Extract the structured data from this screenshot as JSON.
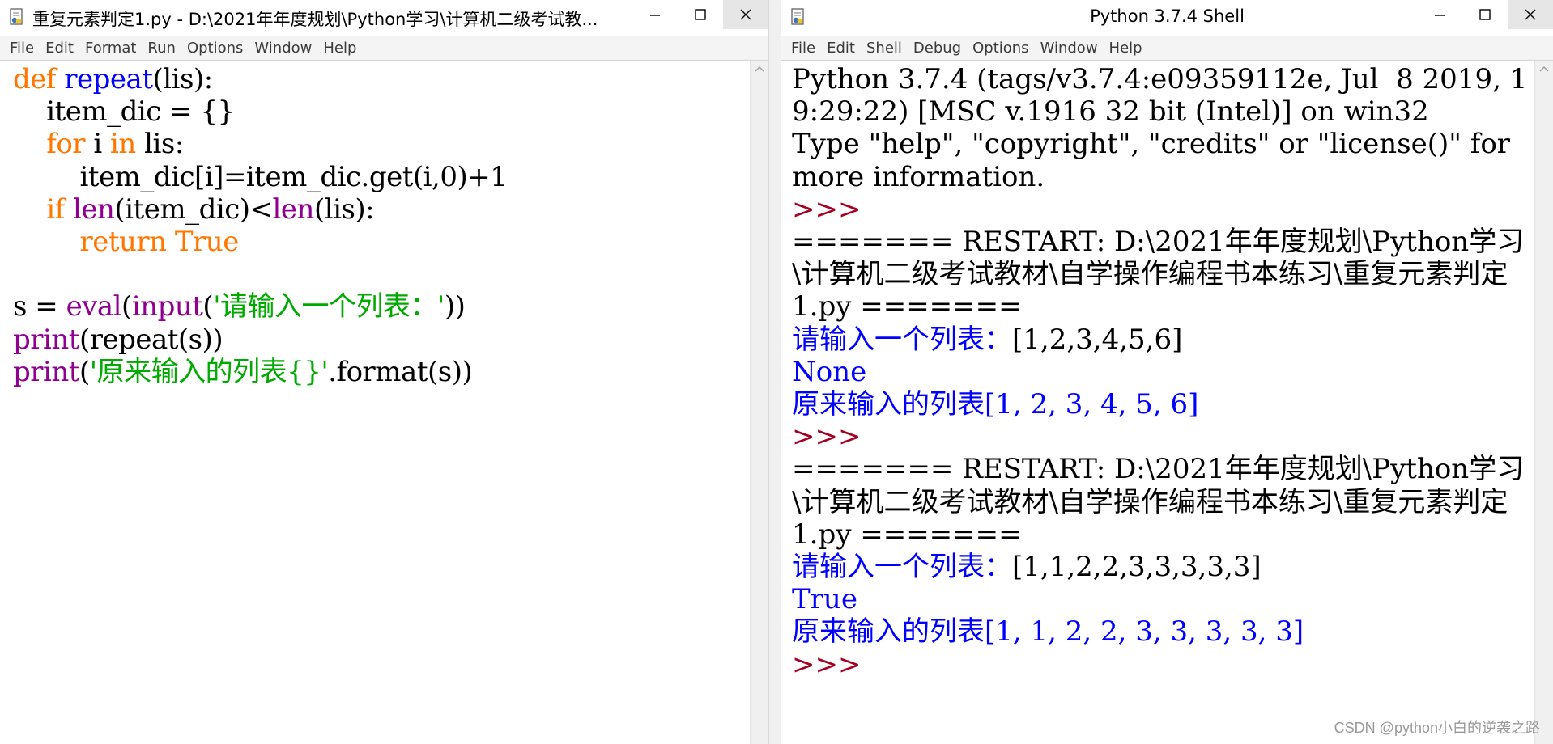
{
  "editor": {
    "title": "重复元素判定1.py - D:\\2021年年度规划\\Python学习\\计算机二级考试教...",
    "menu": [
      "File",
      "Edit",
      "Format",
      "Run",
      "Options",
      "Window",
      "Help"
    ],
    "code_lines": [
      [
        {
          "t": "def",
          "c": "kw"
        },
        {
          "t": " ",
          "c": ""
        },
        {
          "t": "repeat",
          "c": "def"
        },
        {
          "t": "(lis):",
          "c": ""
        }
      ],
      [
        {
          "t": "    item_dic = {}",
          "c": ""
        }
      ],
      [
        {
          "t": "    ",
          "c": ""
        },
        {
          "t": "for",
          "c": "kw"
        },
        {
          "t": " i ",
          "c": ""
        },
        {
          "t": "in",
          "c": "kw"
        },
        {
          "t": " lis:",
          "c": ""
        }
      ],
      [
        {
          "t": "        item_dic[i]=item_dic.get(i,0)+1",
          "c": ""
        }
      ],
      [
        {
          "t": "    ",
          "c": ""
        },
        {
          "t": "if",
          "c": "kw"
        },
        {
          "t": " ",
          "c": ""
        },
        {
          "t": "len",
          "c": "bi"
        },
        {
          "t": "(item_dic)<",
          "c": ""
        },
        {
          "t": "len",
          "c": "bi"
        },
        {
          "t": "(lis):",
          "c": ""
        }
      ],
      [
        {
          "t": "        ",
          "c": ""
        },
        {
          "t": "return",
          "c": "kw"
        },
        {
          "t": " ",
          "c": ""
        },
        {
          "t": "True",
          "c": "kw"
        }
      ],
      [],
      [
        {
          "t": "s = ",
          "c": ""
        },
        {
          "t": "eval",
          "c": "bi"
        },
        {
          "t": "(",
          "c": ""
        },
        {
          "t": "input",
          "c": "bi"
        },
        {
          "t": "(",
          "c": ""
        },
        {
          "t": "'请输入一个列表：'",
          "c": "str"
        },
        {
          "t": "))",
          "c": ""
        }
      ],
      [
        {
          "t": "print",
          "c": "bi"
        },
        {
          "t": "(repeat(s))",
          "c": ""
        }
      ],
      [
        {
          "t": "print",
          "c": "bi"
        },
        {
          "t": "(",
          "c": ""
        },
        {
          "t": "'原来输入的列表{}'",
          "c": "str"
        },
        {
          "t": ".format(s))",
          "c": ""
        }
      ]
    ]
  },
  "shell": {
    "title": "Python 3.7.4 Shell",
    "menu": [
      "File",
      "Edit",
      "Shell",
      "Debug",
      "Options",
      "Window",
      "Help"
    ],
    "lines": [
      [
        {
          "t": "Python 3.7.4 (tags/v3.7.4:e09359112e, Jul  8 2019, 19:29:22) [MSC v.1916 32 bit (Intel)] on win32",
          "c": ""
        }
      ],
      [
        {
          "t": "Type \"help\", \"copyright\", \"credits\" or \"license()\" for more information.",
          "c": ""
        }
      ],
      [
        {
          "t": ">>>",
          "c": "prompt"
        }
      ],
      [
        {
          "t": "======= RESTART: D:\\2021年年度规划\\Python学习\\计算机二级考试教材\\自学操作编程书本练习\\重复元素判定1.py =======",
          "c": ""
        }
      ],
      [
        {
          "t": "请输入一个列表：",
          "c": "out"
        },
        {
          "t": "[1,2,3,4,5,6]",
          "c": ""
        }
      ],
      [
        {
          "t": "None",
          "c": "out"
        }
      ],
      [
        {
          "t": "原来输入的列表[1, 2, 3, 4, 5, 6]",
          "c": "out"
        }
      ],
      [
        {
          "t": ">>>",
          "c": "prompt"
        }
      ],
      [
        {
          "t": "======= RESTART: D:\\2021年年度规划\\Python学习\\计算机二级考试教材\\自学操作编程书本练习\\重复元素判定1.py =======",
          "c": ""
        }
      ],
      [
        {
          "t": "请输入一个列表：",
          "c": "out"
        },
        {
          "t": "[1,1,2,2,3,3,3,3,3]",
          "c": ""
        }
      ],
      [
        {
          "t": "True",
          "c": "out"
        }
      ],
      [
        {
          "t": "原来输入的列表[1, 1, 2, 2, 3, 3, 3, 3, 3]",
          "c": "out"
        }
      ],
      [
        {
          "t": ">>>",
          "c": "prompt"
        }
      ]
    ]
  },
  "watermark": "CSDN @python小白的逆袭之路"
}
